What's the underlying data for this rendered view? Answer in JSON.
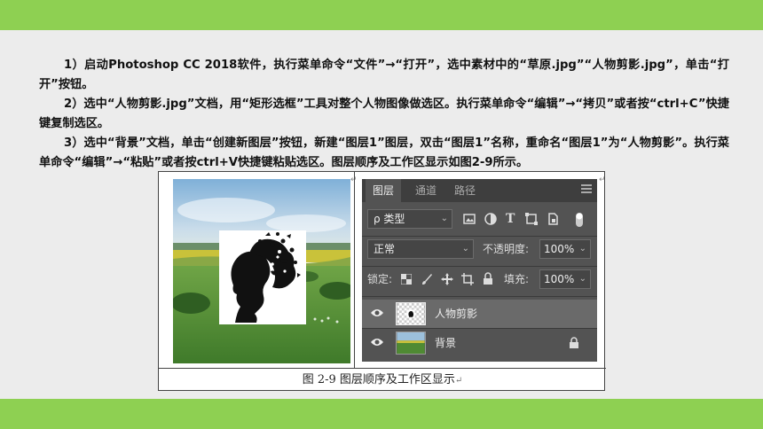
{
  "document": {
    "para1": "1）启动Photoshop CC 2018软件，执行菜单命令“文件”→“打开”，选中素材中的“草原.jpg”“人物剪影.jpg”，单击“打开”按钮。",
    "para2": "2）选中“人物剪影.jpg”文档，用“矩形选框”工具对整个人物图像做选区。执行菜单命令“编辑”→“拷贝”或者按“ctrl+C”快捷键复制选区。",
    "para3": "3）选中“背景”文档，单击“创建新图层”按钮，新建“图层1”图层，双击“图层1”名称，重命名“图层1”为“人物剪影”。执行菜单命令“编辑”→“粘贴”或者按ctrl+V快捷键粘贴选区。图层顺序及工作区显示如图2-9所示。"
  },
  "figure": {
    "caption": "图 2-9  图层顺序及工作区显示",
    "caption_mark": "↵"
  },
  "layers_panel": {
    "tabs": [
      "图层",
      "通道",
      "路径"
    ],
    "filter_label": "ρ 类型",
    "blend_mode": "正常",
    "opacity_label": "不透明度:",
    "opacity_value": "100%",
    "lock_label": "锁定:",
    "fill_label": "填充:",
    "fill_value": "100%",
    "layers": [
      {
        "name": "人物剪影",
        "selected": true,
        "locked": false
      },
      {
        "name": "背景",
        "selected": false,
        "locked": true
      }
    ]
  },
  "colors": {
    "accent_bar": "#8ed052",
    "panel_bg": "#535353"
  }
}
